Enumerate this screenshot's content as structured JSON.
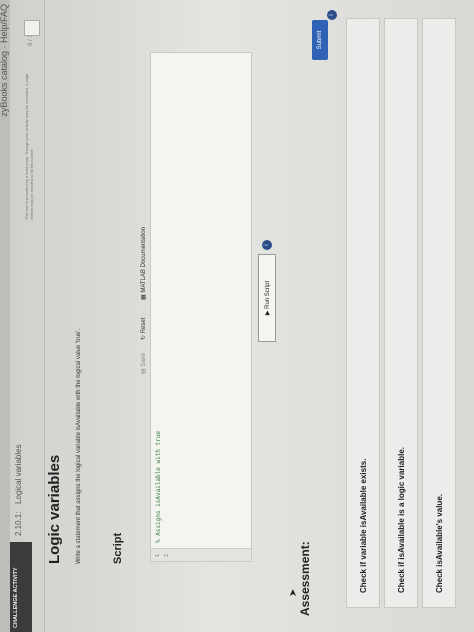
{
  "chrome": {
    "text": "zyBooks catalog  ·  Help/FAQ"
  },
  "challenge": {
    "badge": "CHALLENGE ACTIVITY",
    "activity_number": "2.10.1:",
    "activity_name": "Logical variables",
    "third_party_note": "This tool is provided by a third party. Though your activity may be recorded, a page refresh may be needed to fill the banner.",
    "score": "0 / 1"
  },
  "title": "Logic variables",
  "description": "Write a statement that assigns the logical variable isAvailable with the logical value 'true'.",
  "script": {
    "heading": "Script",
    "toolbar": {
      "save": "Save",
      "reset": "Reset",
      "docs": "MATLAB Documentation"
    },
    "lines": [
      "1",
      "2"
    ],
    "code_line_1": "% Assigns isAvailable with true",
    "run_label": "Run Script",
    "info_icon": "i"
  },
  "assessment": {
    "heading": "Assessment:",
    "submit_label": "Submit",
    "info_icon": "i",
    "checks": [
      "Check if variable isAvailable exists.",
      "Check if isAvailable is a logic variable.",
      "Check isAvailable's value."
    ]
  }
}
